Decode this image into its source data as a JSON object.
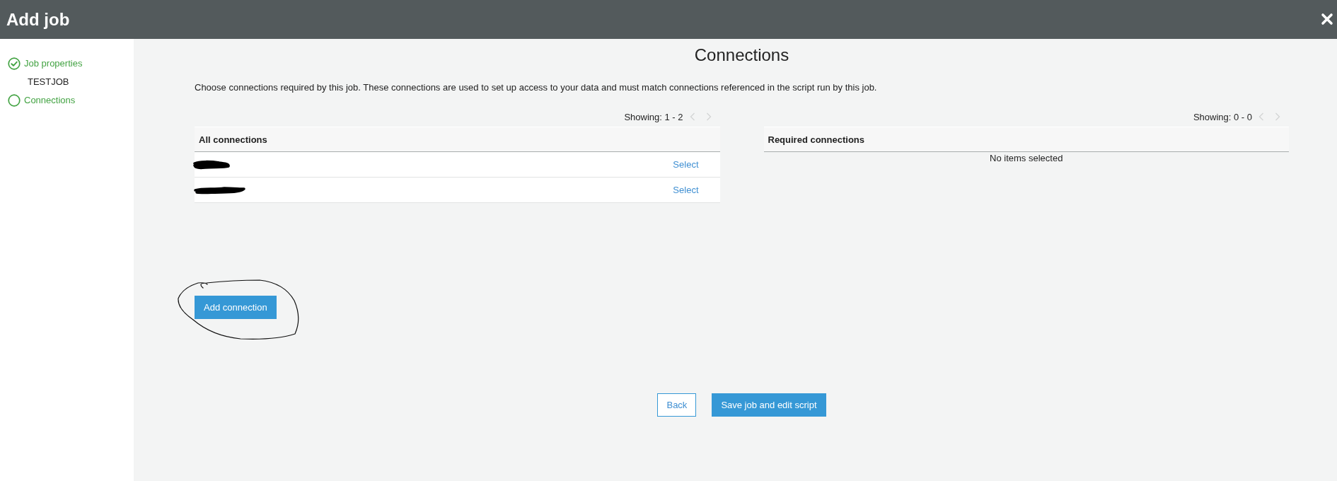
{
  "window": {
    "title": "Add job"
  },
  "sidebar": {
    "steps": [
      {
        "label": "Job properties",
        "completed": true,
        "detail": "TESTJOB"
      },
      {
        "label": "Connections",
        "completed": false
      }
    ]
  },
  "page": {
    "title": "Connections",
    "description": "Choose connections required by this job. These connections are used to set up access to your data and must match connections referenced in the script run by this job."
  },
  "all_connections": {
    "pager": {
      "label": "Showing: 1 - 2",
      "prev_disabled": true,
      "next_disabled": true
    },
    "header": "All connections",
    "rows": [
      {
        "redacted": true,
        "action": "Select"
      },
      {
        "redacted": true,
        "action": "Select"
      }
    ]
  },
  "required_connections": {
    "pager": {
      "label": "Showing: 0 - 0",
      "prev_disabled": true,
      "next_disabled": true
    },
    "header": "Required connections",
    "empty_message": "No items selected"
  },
  "add_connection_button": {
    "label": "Add connection",
    "circled": true
  },
  "footer_buttons": [
    {
      "label": "Back",
      "kind": "secondary"
    },
    {
      "label": "Save job and edit script",
      "kind": "primary"
    }
  ]
}
